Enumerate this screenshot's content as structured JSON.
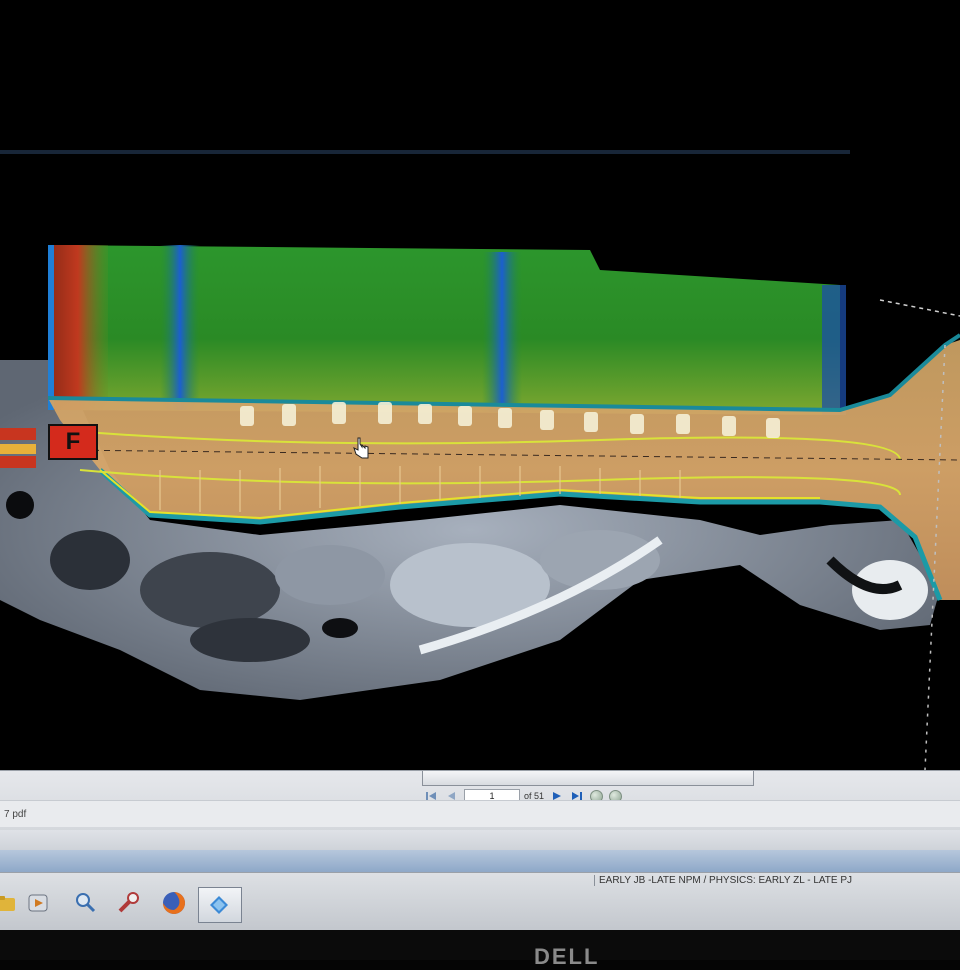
{
  "viewer": {
    "orientation_marker": "F"
  },
  "navigation": {
    "page_value": "1",
    "page_of": "of 51"
  },
  "document": {
    "filename": "7 pdf"
  },
  "status_bar": {
    "text": "EARLY JB -LATE NPM / PHYSICS: EARLY ZL - LATE PJ"
  },
  "taskbar": {
    "icons": [
      "folder-icon",
      "media-player-icon",
      "magnifier-icon",
      "tools-icon",
      "firefox-icon",
      "blue-app-icon"
    ]
  },
  "monitor": {
    "brand": "DELL"
  },
  "colors": {
    "dose_green": "#2e9a2a",
    "dose_red": "#c0392b",
    "dose_blue": "#1e6fd0",
    "marker_red": "#d42a1c"
  }
}
